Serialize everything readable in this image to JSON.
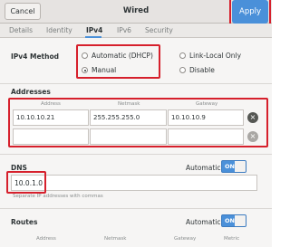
{
  "header": {
    "cancel_label": "Cancel",
    "title": "Wired",
    "apply_label": "Apply"
  },
  "tabs": [
    {
      "label": "Details"
    },
    {
      "label": "Identity"
    },
    {
      "label": "IPv4"
    },
    {
      "label": "IPv6"
    },
    {
      "label": "Security"
    }
  ],
  "active_tab": "IPv4",
  "ipv4": {
    "method_label": "IPv4 Method",
    "options": [
      {
        "label": "Automatic (DHCP)",
        "selected": false
      },
      {
        "label": "Link-Local Only",
        "selected": false
      },
      {
        "label": "Manual",
        "selected": true
      },
      {
        "label": "Disable",
        "selected": false
      }
    ]
  },
  "addresses": {
    "section_label": "Addresses",
    "columns": [
      "Address",
      "Netmask",
      "Gateway"
    ],
    "rows": [
      [
        "10.10.10.21",
        "255.255.255.0",
        "10.10.10.9"
      ],
      [
        "",
        "",
        ""
      ]
    ]
  },
  "dns": {
    "label": "DNS",
    "automatic_label": "Automatic",
    "toggle_label": "ON",
    "value": "10.0.1.0",
    "hint": "Separate IP addresses with commas"
  },
  "routes": {
    "label": "Routes",
    "automatic_label": "Automatic",
    "toggle_label": "ON",
    "columns": [
      "Address",
      "Netmask",
      "Gateway",
      "Metric"
    ]
  },
  "colors": {
    "accent": "#4a90d9",
    "highlight": "#d6202c"
  }
}
